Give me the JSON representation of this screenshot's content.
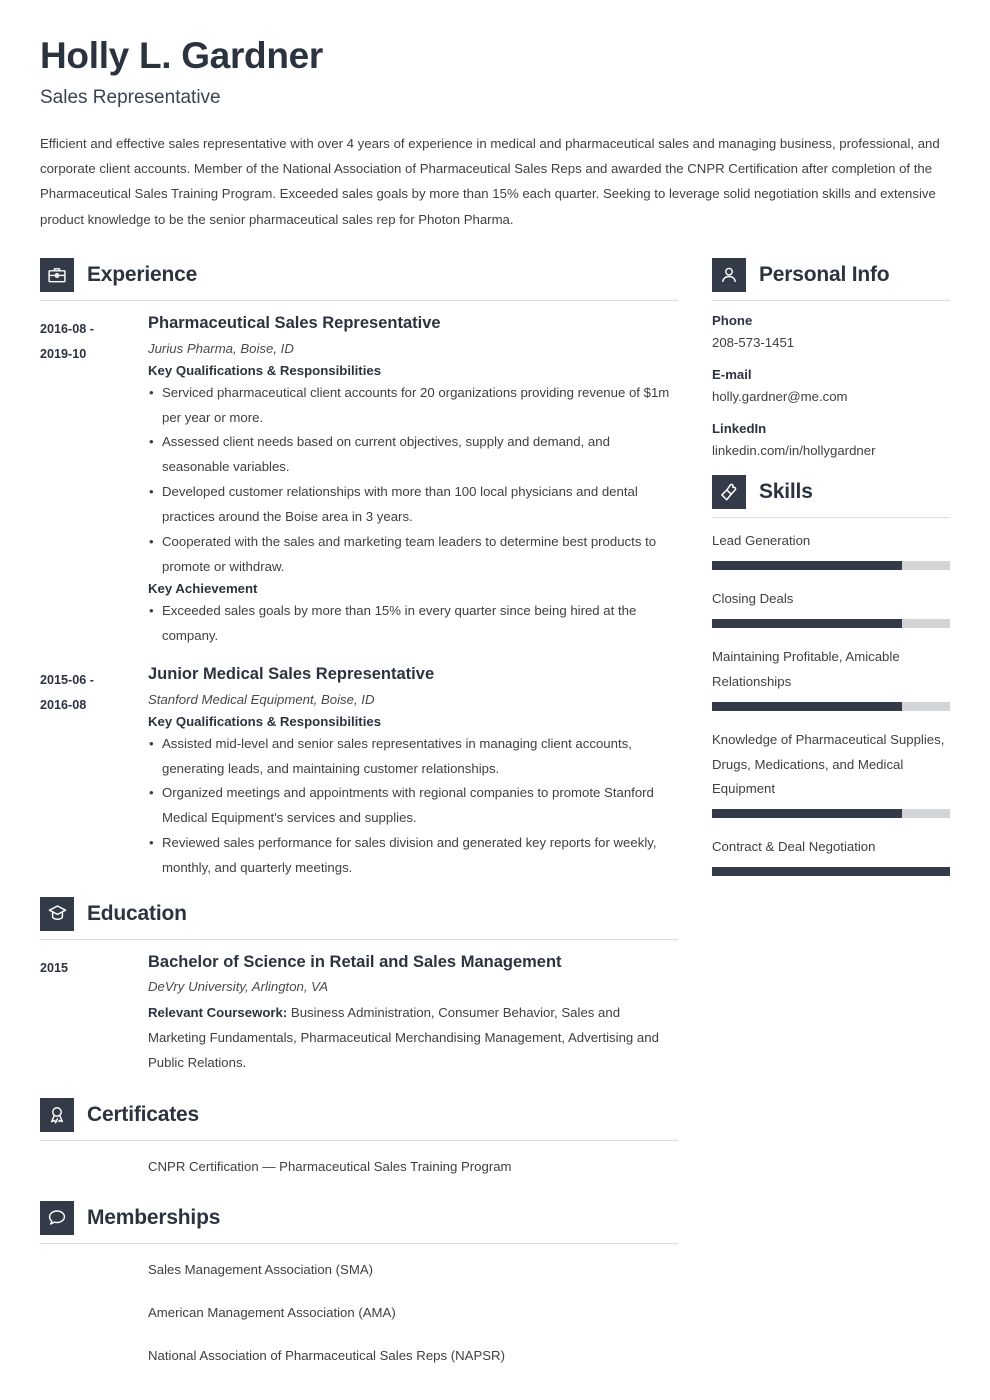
{
  "header": {
    "name": "Holly L. Gardner",
    "job_title": "Sales Representative",
    "summary": "Efficient and effective sales representative with over 4 years of experience in medical and pharmaceutical sales and managing business, professional, and corporate client accounts. Member of the National Association of Pharmaceutical Sales Reps and awarded the CNPR Certification after completion of the Pharmaceutical Sales Training Program. Exceeded sales goals by more than 15% each quarter. Seeking to leverage solid negotiation skills and extensive product knowledge to be the senior pharmaceutical sales rep for Photon Pharma."
  },
  "theme": {
    "accent_dark": "#343b48",
    "heading_color": "#2c3340",
    "body_color": "#404040",
    "rule_color": "#dcdcdc",
    "bar_track": "#d2d4d6"
  },
  "sections": {
    "experience": {
      "title": "Experience",
      "icon": "briefcase-icon",
      "entries": [
        {
          "date_from": "2016-08 -",
          "date_to": "2019-10",
          "role": "Pharmaceutical Sales Representative",
          "org": "Jurius Pharma, Boise, ID",
          "groups": [
            {
              "label": "Key Qualifications & Responsibilities",
              "bullets": [
                "Serviced pharmaceutical client accounts for 20 organizations providing revenue of $1m per year or more.",
                "Assessed client needs based on current objectives, supply and demand, and seasonable variables.",
                "Developed customer relationships with more than 100 local physicians and dental practices around the Boise area in 3 years.",
                "Cooperated with the sales and marketing team leaders to determine best products to promote or withdraw."
              ]
            },
            {
              "label": "Key Achievement",
              "bullets": [
                "Exceeded sales goals by more than 15% in every quarter since being hired at the company."
              ]
            }
          ]
        },
        {
          "date_from": "2015-06 -",
          "date_to": "2016-08",
          "role": "Junior Medical Sales Representative",
          "org": "Stanford Medical Equipment, Boise, ID",
          "groups": [
            {
              "label": "Key Qualifications & Responsibilities",
              "bullets": [
                "Assisted mid-level and senior sales representatives in managing client accounts, generating leads, and maintaining customer relationships.",
                "Organized meetings and appointments with regional companies to promote Stanford Medical Equipment's services and supplies.",
                "Reviewed sales performance for sales division and generated key reports for weekly, monthly, and quarterly meetings."
              ]
            }
          ]
        }
      ]
    },
    "education": {
      "title": "Education",
      "icon": "graduation-cap-icon",
      "entries": [
        {
          "date": "2015",
          "degree": "Bachelor of Science in Retail and Sales Management",
          "school": "DeVry University, Arlington, VA",
          "coursework_label": "Relevant Coursework:",
          "coursework": " Business Administration, Consumer Behavior, Sales and Marketing Fundamentals, Pharmaceutical Merchandising Management, Advertising and Public Relations."
        }
      ]
    },
    "certificates": {
      "title": "Certificates",
      "icon": "award-ribbon-icon",
      "items": [
        "CNPR Certification — Pharmaceutical Sales Training Program"
      ]
    },
    "memberships": {
      "title": "Memberships",
      "icon": "speech-bubble-icon",
      "items": [
        "Sales Management Association (SMA)",
        "American Management Association (AMA)",
        "National Association of Pharmaceutical Sales Reps (NAPSR)"
      ]
    },
    "personal_info": {
      "title": "Personal Info",
      "icon": "person-icon",
      "fields": [
        {
          "label": "Phone",
          "value": "208-573-1451"
        },
        {
          "label": "E-mail",
          "value": "holly.gardner@me.com"
        },
        {
          "label": "LinkedIn",
          "value": "linkedin.com/in/hollygardner"
        }
      ]
    },
    "skills": {
      "title": "Skills",
      "icon": "puzzle-piece-icon",
      "items": [
        {
          "name": "Lead Generation",
          "level": 80
        },
        {
          "name": "Closing Deals",
          "level": 80
        },
        {
          "name": "Maintaining Profitable, Amicable Relationships",
          "level": 80
        },
        {
          "name": "Knowledge of Pharmaceutical Supplies, Drugs, Medications, and Medical Equipment",
          "level": 80
        },
        {
          "name": "Contract & Deal Negotiation",
          "level": 100
        }
      ]
    }
  }
}
